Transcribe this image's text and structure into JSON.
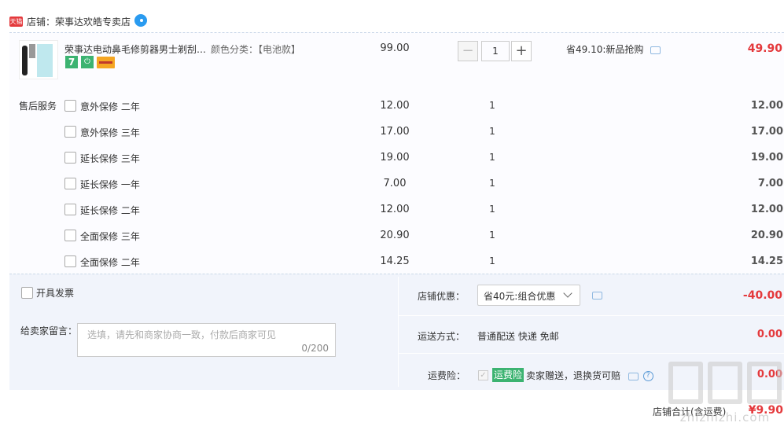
{
  "shop": {
    "badge": "天猫",
    "label": "店铺：荣事达欢皓专卖店"
  },
  "item": {
    "title": "荣事达电动鼻毛修剪器男士剃刮…",
    "sku": "颜色分类：【电池款】",
    "tag_7": "7",
    "tag_b": "⏻",
    "price": "99.00",
    "quantity": "1",
    "minus": "−",
    "plus": "+",
    "promo": "省49.10:新品抢购",
    "subtotal": "49.90"
  },
  "services": {
    "label": "售后服务",
    "rows": [
      {
        "name": "意外保修 二年",
        "price": "12.00",
        "qty": "1",
        "sum": "12.00"
      },
      {
        "name": "意外保修 三年",
        "price": "17.00",
        "qty": "1",
        "sum": "17.00"
      },
      {
        "name": "延长保修 三年",
        "price": "19.00",
        "qty": "1",
        "sum": "19.00"
      },
      {
        "name": "延长保修 一年",
        "price": "7.00",
        "qty": "1",
        "sum": "7.00"
      },
      {
        "name": "延长保修 二年",
        "price": "12.00",
        "qty": "1",
        "sum": "12.00"
      },
      {
        "name": "全面保修 三年",
        "price": "20.90",
        "qty": "1",
        "sum": "20.90"
      },
      {
        "name": "全面保修 二年",
        "price": "14.25",
        "qty": "1",
        "sum": "14.25"
      }
    ]
  },
  "invoice": {
    "label": "开具发票"
  },
  "message": {
    "label": "给卖家留言：",
    "placeholder": "选填，请先和商家协商一致，付款后商家可见",
    "counter": "0/200"
  },
  "discount": {
    "label": "店铺优惠：",
    "selected": "省40元:组合优惠",
    "value": "-40.00"
  },
  "shipping": {
    "label": "运送方式：",
    "method": "普通配送 快递 免邮",
    "value": "0.00"
  },
  "insurance": {
    "label": "运费险：",
    "check": "✓",
    "badge": "运费险",
    "text": "卖家赠送，退换货可赔",
    "help": "?",
    "value": "0.00"
  },
  "total": {
    "label": "店铺合计(含运费)",
    "value": "¥9.90"
  },
  "watermark": {
    "text": "zhizhizhi.com"
  },
  "colors": {
    "accent_red": "#e4393c",
    "green_tag": "#3cb371",
    "panel_bg": "#f1f4fb"
  },
  "icons": [
    "tmall-badge-icon",
    "wangwang-chat-icon",
    "chat-bubble-icon",
    "question-icon",
    "chevron-down-icon",
    "checkbox-icon"
  ]
}
